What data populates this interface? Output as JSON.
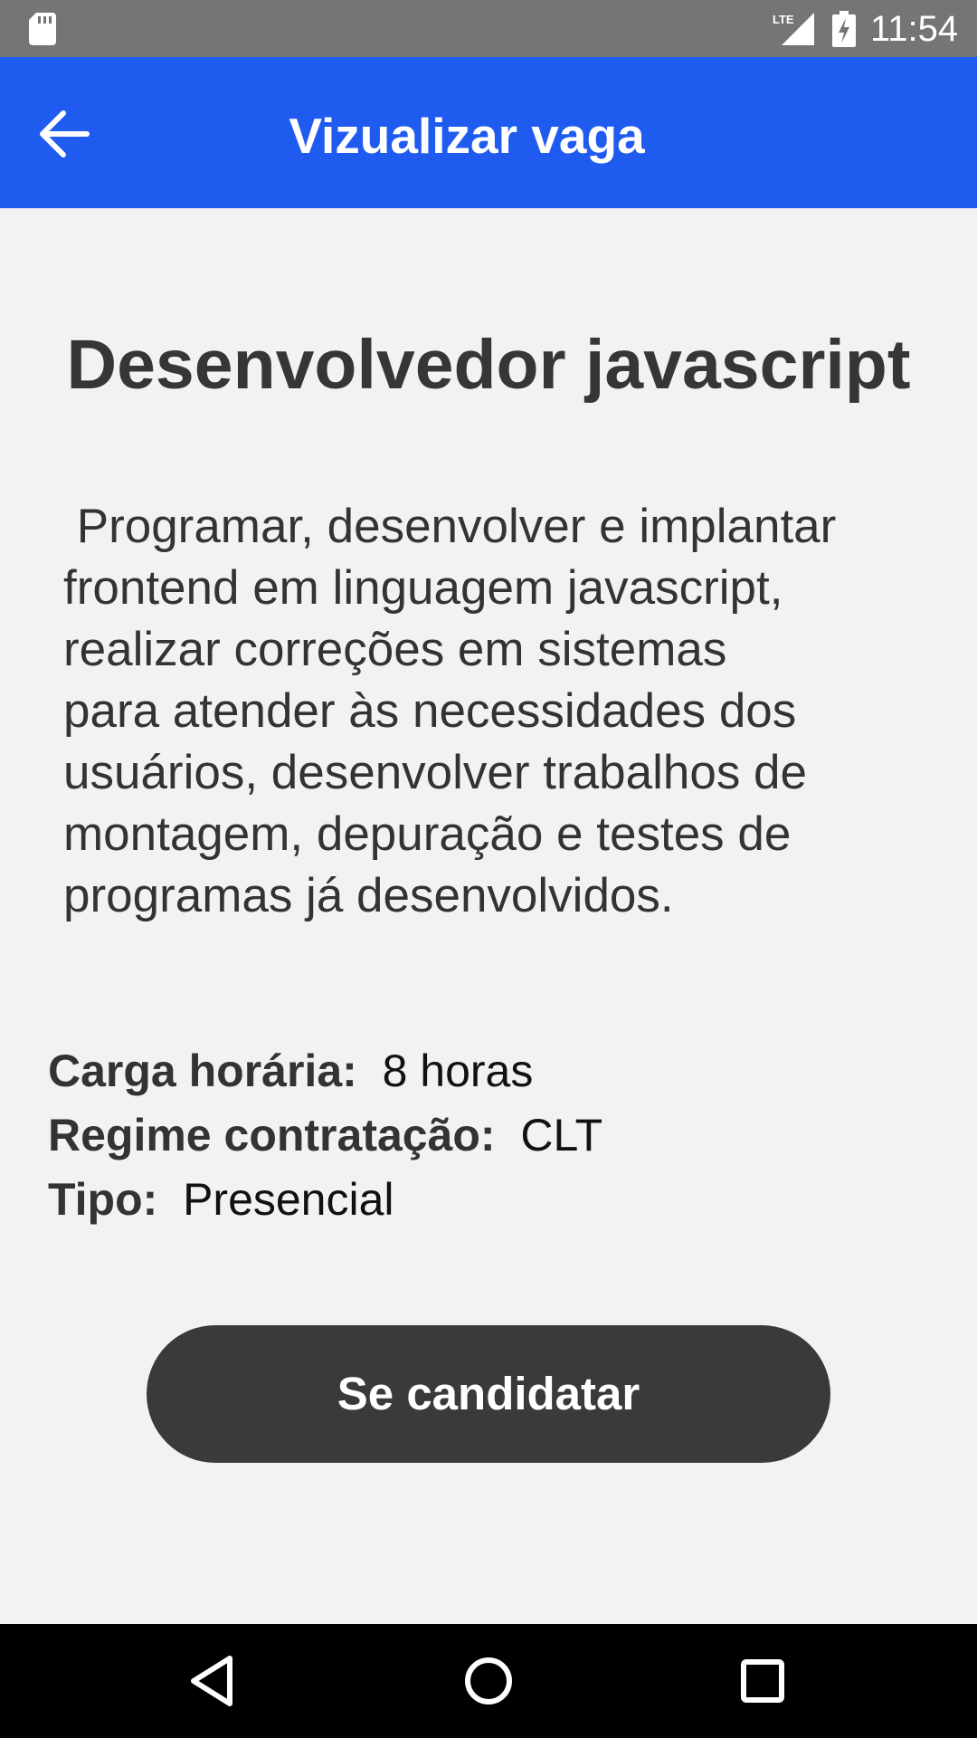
{
  "status_bar": {
    "time": "11:54",
    "icons": [
      "sd-card-icon",
      "lte-signal-icon",
      "battery-charging-icon"
    ],
    "network_label": "LTE"
  },
  "app_bar": {
    "title": "Vizualizar vaga",
    "back_icon": "arrow-back-icon",
    "color": "#1f5bef"
  },
  "job": {
    "title": "Desenvolvedor javascript",
    "description": " Programar, desenvolver e implantar\nfrontend em linguagem javascript,\nrealizar correções em sistemas\npara atender às necessidades dos\nusuários, desenvolver trabalhos de\nmontagem, depuração e testes de\nprogramas já desenvolvidos.",
    "details": [
      {
        "label": "Carga horária:",
        "value": "8 horas"
      },
      {
        "label": "Regime contratação:",
        "value": "CLT"
      },
      {
        "label": "Tipo:",
        "value": "Presencial"
      }
    ]
  },
  "actions": {
    "apply_label": "Se candidatar",
    "apply_color": "#3a3a3a"
  },
  "nav_bar": {
    "icons": [
      "nav-back-icon",
      "nav-home-icon",
      "nav-recents-icon"
    ]
  }
}
